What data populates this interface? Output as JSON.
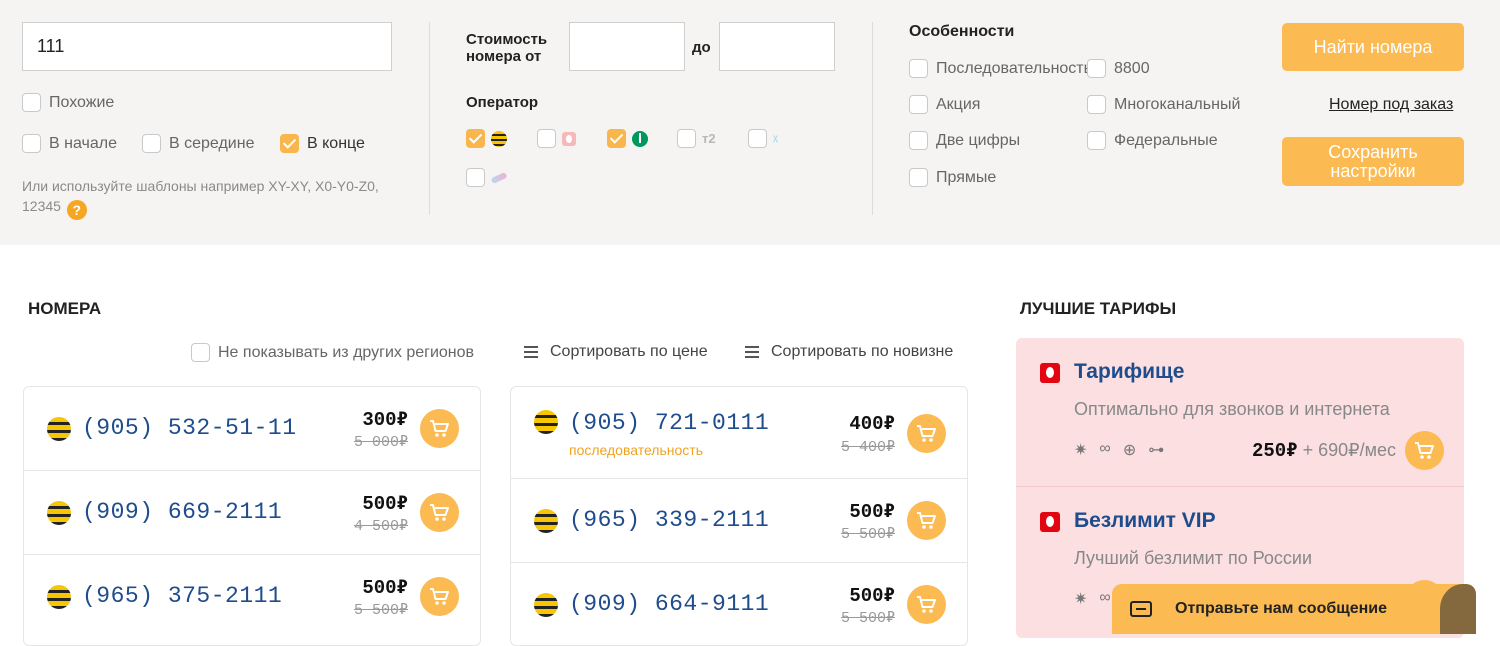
{
  "search": {
    "value": "111"
  },
  "match": {
    "similar": "Похожие",
    "start": "В начале",
    "middle": "В середине",
    "end": "В конце"
  },
  "hint": "Или используйте шаблоны например XY-XY, X0-Y0-Z0, 12345",
  "hint_icon": "?",
  "price": {
    "label_line1": "Стоимость",
    "label_line2": "номера от",
    "to": "до"
  },
  "operator": {
    "title": "Оператор",
    "t2": "т2",
    "yota": "ᵡ"
  },
  "features": {
    "title": "Особенности",
    "items": [
      "Последовательность",
      "8800",
      "Акция",
      "Многоканальный",
      "Две цифры",
      "Федеральные",
      "Прямые"
    ]
  },
  "buttons": {
    "find": "Найти номера",
    "order": "Номер под заказ",
    "save_line1": "Сохранить",
    "save_line2": "настройки"
  },
  "numbers": {
    "title": "НОМЕРА",
    "hide_regions": "Не показывать из других регионов",
    "sort_price": "Сортировать по цене",
    "sort_new": "Сортировать по новизне",
    "left": [
      {
        "number": "(905) 532-51-11",
        "price": "300₽",
        "old": "5 000₽"
      },
      {
        "number": "(909) 669-2111",
        "price": "500₽",
        "old": "4 500₽"
      },
      {
        "number": "(965) 375-2111",
        "price": "500₽",
        "old": "5 500₽"
      }
    ],
    "right": [
      {
        "number": "(905) 721-0111",
        "tag": "последовательность",
        "price": "400₽",
        "old": "5 400₽"
      },
      {
        "number": "(965) 339-2111",
        "price": "500₽",
        "old": "5 500₽"
      },
      {
        "number": "(909) 664-9111",
        "price": "500₽",
        "old": "5 500₽"
      }
    ]
  },
  "tariffs": {
    "title": "ЛУЧШИЕ ТАРИФЫ",
    "items": [
      {
        "name": "Тарифище",
        "desc": "Оптимально для звонков и интернета",
        "price": "250₽",
        "monthly": "+ 690₽/мес"
      },
      {
        "name": "Безлимит VIP",
        "desc": "Лучший безлимит по России"
      }
    ],
    "icons": [
      "✷",
      "∞",
      "⊕",
      "⊶"
    ]
  },
  "chat": {
    "label": "Отправьте нам сообщение"
  },
  "colors": {
    "accent": "#fbba52",
    "number_blue": "#1e4c8c",
    "tariff_bg": "#fbdfe1"
  }
}
